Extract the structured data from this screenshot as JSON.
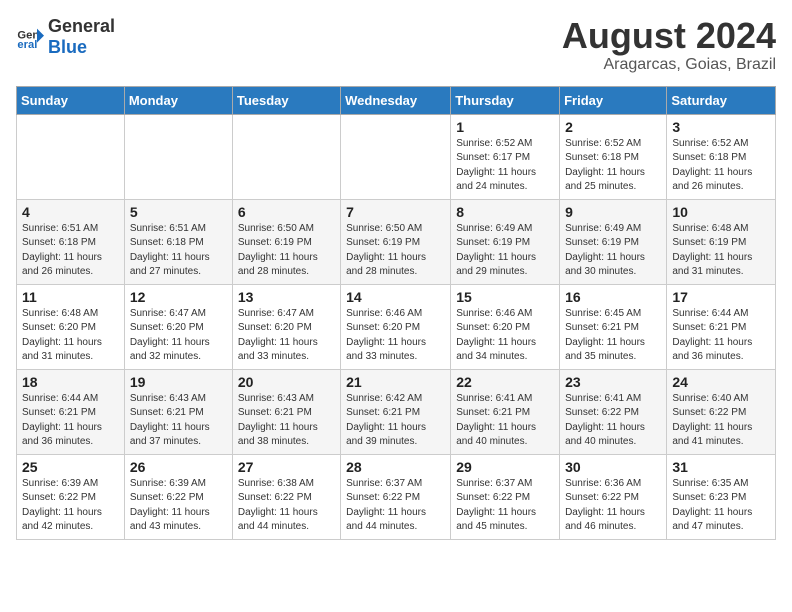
{
  "logo": {
    "text_general": "General",
    "text_blue": "Blue"
  },
  "title": {
    "month_year": "August 2024",
    "location": "Aragarcas, Goias, Brazil"
  },
  "weekdays": [
    "Sunday",
    "Monday",
    "Tuesday",
    "Wednesday",
    "Thursday",
    "Friday",
    "Saturday"
  ],
  "weeks": [
    [
      {
        "day": "",
        "sunrise": "",
        "sunset": "",
        "daylight": ""
      },
      {
        "day": "",
        "sunrise": "",
        "sunset": "",
        "daylight": ""
      },
      {
        "day": "",
        "sunrise": "",
        "sunset": "",
        "daylight": ""
      },
      {
        "day": "",
        "sunrise": "",
        "sunset": "",
        "daylight": ""
      },
      {
        "day": "1",
        "sunrise": "Sunrise: 6:52 AM",
        "sunset": "Sunset: 6:17 PM",
        "daylight": "Daylight: 11 hours and 24 minutes."
      },
      {
        "day": "2",
        "sunrise": "Sunrise: 6:52 AM",
        "sunset": "Sunset: 6:18 PM",
        "daylight": "Daylight: 11 hours and 25 minutes."
      },
      {
        "day": "3",
        "sunrise": "Sunrise: 6:52 AM",
        "sunset": "Sunset: 6:18 PM",
        "daylight": "Daylight: 11 hours and 26 minutes."
      }
    ],
    [
      {
        "day": "4",
        "sunrise": "Sunrise: 6:51 AM",
        "sunset": "Sunset: 6:18 PM",
        "daylight": "Daylight: 11 hours and 26 minutes."
      },
      {
        "day": "5",
        "sunrise": "Sunrise: 6:51 AM",
        "sunset": "Sunset: 6:18 PM",
        "daylight": "Daylight: 11 hours and 27 minutes."
      },
      {
        "day": "6",
        "sunrise": "Sunrise: 6:50 AM",
        "sunset": "Sunset: 6:19 PM",
        "daylight": "Daylight: 11 hours and 28 minutes."
      },
      {
        "day": "7",
        "sunrise": "Sunrise: 6:50 AM",
        "sunset": "Sunset: 6:19 PM",
        "daylight": "Daylight: 11 hours and 28 minutes."
      },
      {
        "day": "8",
        "sunrise": "Sunrise: 6:49 AM",
        "sunset": "Sunset: 6:19 PM",
        "daylight": "Daylight: 11 hours and 29 minutes."
      },
      {
        "day": "9",
        "sunrise": "Sunrise: 6:49 AM",
        "sunset": "Sunset: 6:19 PM",
        "daylight": "Daylight: 11 hours and 30 minutes."
      },
      {
        "day": "10",
        "sunrise": "Sunrise: 6:48 AM",
        "sunset": "Sunset: 6:19 PM",
        "daylight": "Daylight: 11 hours and 31 minutes."
      }
    ],
    [
      {
        "day": "11",
        "sunrise": "Sunrise: 6:48 AM",
        "sunset": "Sunset: 6:20 PM",
        "daylight": "Daylight: 11 hours and 31 minutes."
      },
      {
        "day": "12",
        "sunrise": "Sunrise: 6:47 AM",
        "sunset": "Sunset: 6:20 PM",
        "daylight": "Daylight: 11 hours and 32 minutes."
      },
      {
        "day": "13",
        "sunrise": "Sunrise: 6:47 AM",
        "sunset": "Sunset: 6:20 PM",
        "daylight": "Daylight: 11 hours and 33 minutes."
      },
      {
        "day": "14",
        "sunrise": "Sunrise: 6:46 AM",
        "sunset": "Sunset: 6:20 PM",
        "daylight": "Daylight: 11 hours and 33 minutes."
      },
      {
        "day": "15",
        "sunrise": "Sunrise: 6:46 AM",
        "sunset": "Sunset: 6:20 PM",
        "daylight": "Daylight: 11 hours and 34 minutes."
      },
      {
        "day": "16",
        "sunrise": "Sunrise: 6:45 AM",
        "sunset": "Sunset: 6:21 PM",
        "daylight": "Daylight: 11 hours and 35 minutes."
      },
      {
        "day": "17",
        "sunrise": "Sunrise: 6:44 AM",
        "sunset": "Sunset: 6:21 PM",
        "daylight": "Daylight: 11 hours and 36 minutes."
      }
    ],
    [
      {
        "day": "18",
        "sunrise": "Sunrise: 6:44 AM",
        "sunset": "Sunset: 6:21 PM",
        "daylight": "Daylight: 11 hours and 36 minutes."
      },
      {
        "day": "19",
        "sunrise": "Sunrise: 6:43 AM",
        "sunset": "Sunset: 6:21 PM",
        "daylight": "Daylight: 11 hours and 37 minutes."
      },
      {
        "day": "20",
        "sunrise": "Sunrise: 6:43 AM",
        "sunset": "Sunset: 6:21 PM",
        "daylight": "Daylight: 11 hours and 38 minutes."
      },
      {
        "day": "21",
        "sunrise": "Sunrise: 6:42 AM",
        "sunset": "Sunset: 6:21 PM",
        "daylight": "Daylight: 11 hours and 39 minutes."
      },
      {
        "day": "22",
        "sunrise": "Sunrise: 6:41 AM",
        "sunset": "Sunset: 6:21 PM",
        "daylight": "Daylight: 11 hours and 40 minutes."
      },
      {
        "day": "23",
        "sunrise": "Sunrise: 6:41 AM",
        "sunset": "Sunset: 6:22 PM",
        "daylight": "Daylight: 11 hours and 40 minutes."
      },
      {
        "day": "24",
        "sunrise": "Sunrise: 6:40 AM",
        "sunset": "Sunset: 6:22 PM",
        "daylight": "Daylight: 11 hours and 41 minutes."
      }
    ],
    [
      {
        "day": "25",
        "sunrise": "Sunrise: 6:39 AM",
        "sunset": "Sunset: 6:22 PM",
        "daylight": "Daylight: 11 hours and 42 minutes."
      },
      {
        "day": "26",
        "sunrise": "Sunrise: 6:39 AM",
        "sunset": "Sunset: 6:22 PM",
        "daylight": "Daylight: 11 hours and 43 minutes."
      },
      {
        "day": "27",
        "sunrise": "Sunrise: 6:38 AM",
        "sunset": "Sunset: 6:22 PM",
        "daylight": "Daylight: 11 hours and 44 minutes."
      },
      {
        "day": "28",
        "sunrise": "Sunrise: 6:37 AM",
        "sunset": "Sunset: 6:22 PM",
        "daylight": "Daylight: 11 hours and 44 minutes."
      },
      {
        "day": "29",
        "sunrise": "Sunrise: 6:37 AM",
        "sunset": "Sunset: 6:22 PM",
        "daylight": "Daylight: 11 hours and 45 minutes."
      },
      {
        "day": "30",
        "sunrise": "Sunrise: 6:36 AM",
        "sunset": "Sunset: 6:22 PM",
        "daylight": "Daylight: 11 hours and 46 minutes."
      },
      {
        "day": "31",
        "sunrise": "Sunrise: 6:35 AM",
        "sunset": "Sunset: 6:23 PM",
        "daylight": "Daylight: 11 hours and 47 minutes."
      }
    ]
  ]
}
